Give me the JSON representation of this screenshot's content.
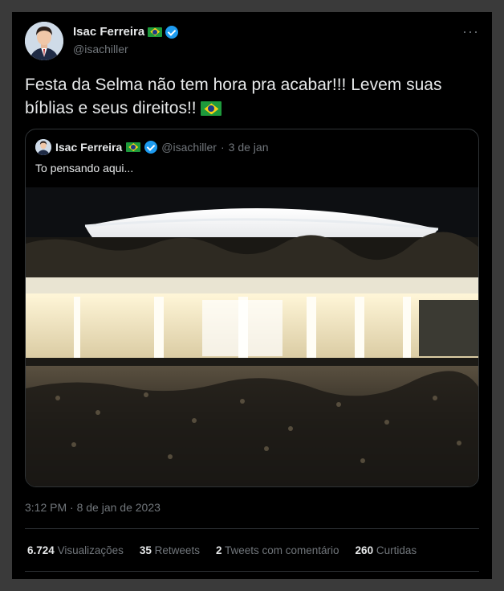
{
  "author": {
    "name": "Isac Ferreira",
    "handle": "@isachiller"
  },
  "tweet": {
    "text": "Festa da Selma não tem hora pra acabar!!! Levem suas bíblias e seus direitos!!",
    "more_icon": "more-icon"
  },
  "quoted": {
    "name": "Isac Ferreira",
    "handle": "@isachiller",
    "separator": "·",
    "date": "3 de jan",
    "text": "To pensando aqui..."
  },
  "timestamp": "3:12 PM · 8 de jan de 2023",
  "stats": {
    "views_count": "6.724",
    "views_label": "Visualizações",
    "retweets_count": "35",
    "retweets_label": "Retweets",
    "quotes_count": "2",
    "quotes_label": "Tweets com comentário",
    "likes_count": "260",
    "likes_label": "Curtidas"
  },
  "colors": {
    "background": "#000000",
    "frame": "#3a3a3a",
    "text": "#e7e9ea",
    "secondary": "#71767b",
    "verified": "#1d9bf0",
    "border": "#2f3336"
  }
}
